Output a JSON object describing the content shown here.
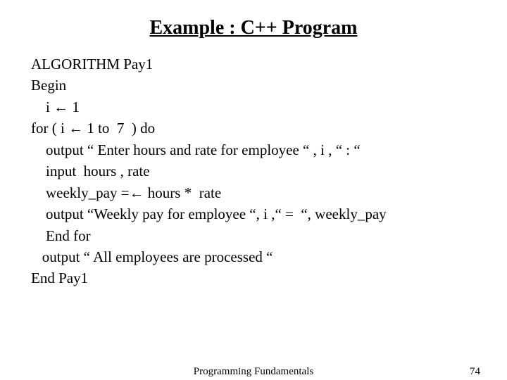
{
  "title": "Example : C++ Program",
  "lines": {
    "l0": "ALGORITHM Pay1",
    "l1": "Begin",
    "l2": "    i ← 1",
    "l3": "for ( i ← 1 to  7  ) do",
    "l4": "    output “ Enter hours and rate for employee “ , i , “ : “",
    "l5": "    input  hours , rate",
    "l6": "    weekly_pay =← hours *  rate",
    "l7": "    output “Weekly pay for employee “, i ,“ =  “, weekly_pay",
    "l8": "    End for",
    "l9": "   output “ All employees are processed “",
    "l10": "End Pay1"
  },
  "footer": {
    "center": "Programming Fundamentals",
    "page": "74"
  }
}
